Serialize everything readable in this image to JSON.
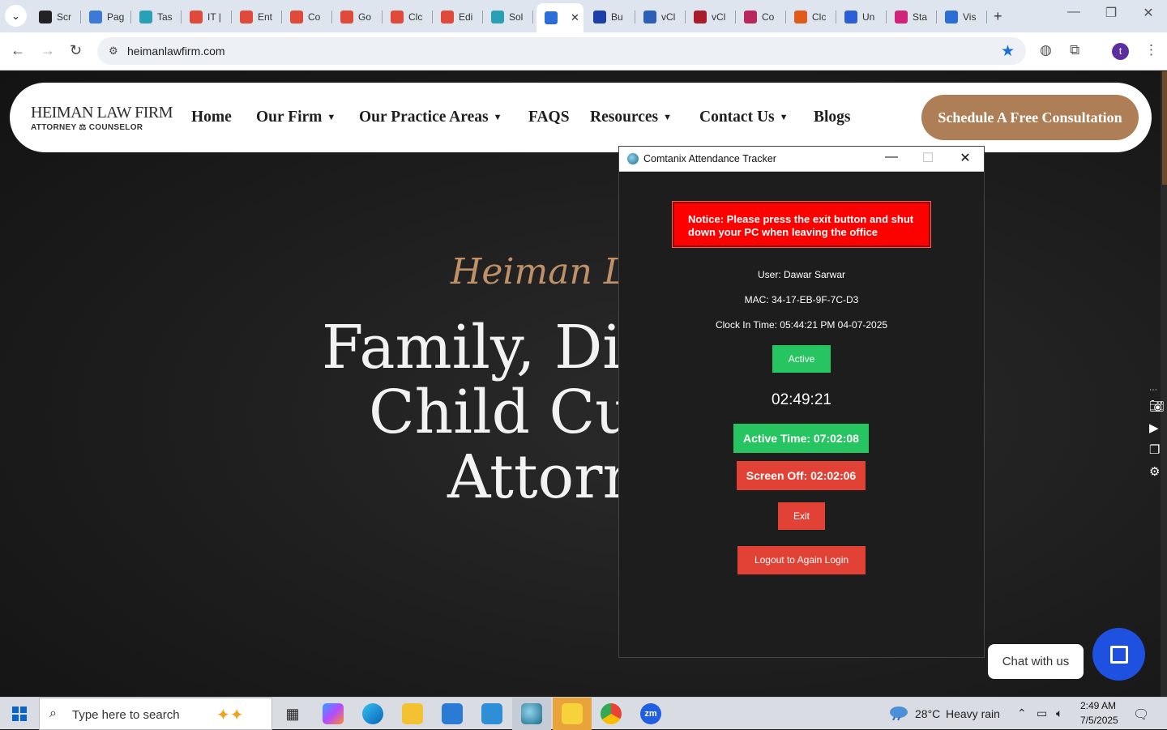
{
  "browser": {
    "tabs": [
      {
        "label": "Scr",
        "color": "#222"
      },
      {
        "label": "Pag",
        "color": "#3b7bd6"
      },
      {
        "label": "Tas",
        "color": "#2aa0b8"
      },
      {
        "label": "IT |",
        "color": "#e04a3a"
      },
      {
        "label": "Ent",
        "color": "#e04a3a"
      },
      {
        "label": "Co",
        "color": "#e04a3a"
      },
      {
        "label": "Go",
        "color": "#e04a3a"
      },
      {
        "label": "Clc",
        "color": "#e04a3a"
      },
      {
        "label": "Edi",
        "color": "#e04a3a"
      },
      {
        "label": "Sol",
        "color": "#2aa0b8"
      },
      {
        "label": "",
        "color": "#2b6fd6"
      },
      {
        "label": "Bu",
        "color": "#1c3fa8"
      },
      {
        "label": "vCl",
        "color": "#2b5fb8"
      },
      {
        "label": "vCl",
        "color": "#a81c2b"
      },
      {
        "label": "Co",
        "color": "#b8285d"
      },
      {
        "label": "Clc",
        "color": "#e05a1a"
      },
      {
        "label": "Un",
        "color": "#2b5fd6"
      },
      {
        "label": "Sta",
        "color": "#d0247a"
      },
      {
        "label": "Vis",
        "color": "#2b6fd6"
      }
    ],
    "active_tab_close": "✕",
    "new_tab": "+",
    "url": "heimanlawfirm.com",
    "profile_initial": "t"
  },
  "site": {
    "logo_main": "HEIMAN LAW FIRM",
    "logo_sub": "ATTORNEY ⚖ COUNSELOR",
    "nav": [
      {
        "label": "Home",
        "caret": false
      },
      {
        "label": "Our Firm",
        "caret": true
      },
      {
        "label": "Our Practice Areas",
        "caret": true
      },
      {
        "label": "FAQS",
        "caret": false
      },
      {
        "label": "Resources",
        "caret": true
      },
      {
        "label": "Contact Us",
        "caret": true
      },
      {
        "label": "Blogs",
        "caret": false
      }
    ],
    "cta": "Schedule A Free Consultation",
    "hero_script": "Heiman Lau",
    "hero_lines": [
      "Family, Div",
      "Child Cu",
      "Attorr"
    ],
    "chat_label": "Chat with us"
  },
  "tracker": {
    "title": "Comtanix Attendance Tracker",
    "notice": "Notice: Please press the exit button and shut down your PC when leaving the office",
    "user": "User: Dawar Sarwar",
    "mac": "MAC: 34-17-EB-9F-7C-D3",
    "clock_in": "Clock In Time: 05:44:21 PM 04-07-2025",
    "status": "Active",
    "timer": "02:49:21",
    "active_time": "Active Time: 07:02:08",
    "screen_off": "Screen Off: 02:02:06",
    "exit": "Exit",
    "logout": "Logout to Again Login",
    "colors": {
      "green": "#27c561",
      "red": "#e24235",
      "notice": "#ff0000"
    }
  },
  "taskbar": {
    "search_placeholder": "Type here to search",
    "weather_temp": "28°C",
    "weather_text": "Heavy rain",
    "time": "2:49 AM",
    "date": "7/5/2025"
  }
}
